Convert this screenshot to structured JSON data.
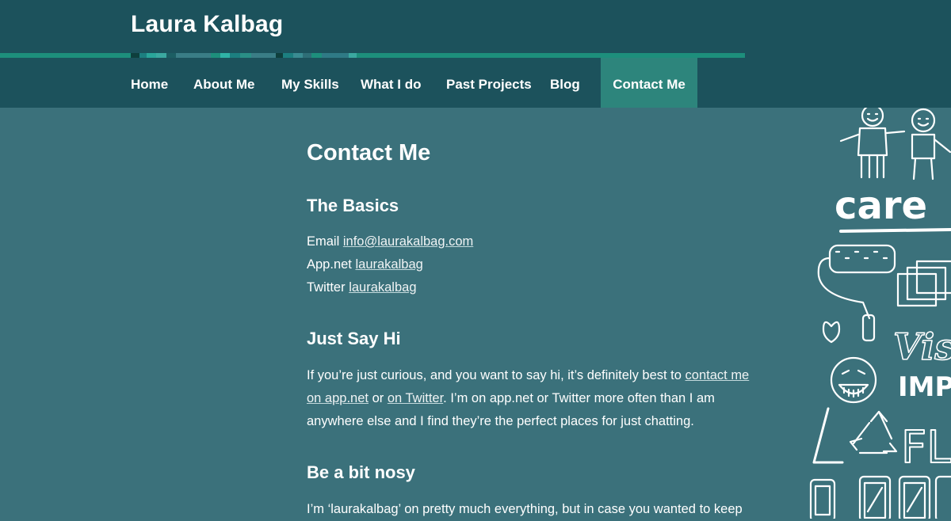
{
  "site": {
    "title": "Laura Kalbag"
  },
  "colors": {
    "header_bg": "#1c525c",
    "page_bg": "#3b717b",
    "accent": "#1d8f7c",
    "active_nav_bg": "#2d857c"
  },
  "nav": {
    "items": [
      {
        "label": "Home"
      },
      {
        "label": "About Me"
      },
      {
        "label": "My Skills"
      },
      {
        "label": "What I do"
      },
      {
        "label": "Past Projects"
      },
      {
        "label": "Blog"
      },
      {
        "label": "Contact Me"
      }
    ],
    "active": "Contact Me"
  },
  "main": {
    "title": "Contact Me",
    "basics": {
      "heading": "The Basics",
      "email_label": "Email",
      "email_link": "info@laurakalbag.com",
      "appnet_label": "App.net",
      "appnet_link": "laurakalbag",
      "twitter_label": "Twitter",
      "twitter_link": "laurakalbag"
    },
    "say_hi": {
      "heading": "Just Say Hi",
      "text_1": "If you’re just curious, and you want to say hi, it’s definitely best to ",
      "link_1": "contact me on app.net",
      "text_2": " or ",
      "link_2": "on Twitter",
      "text_3": ". I’m on app.net or Twitter more often than I am anywhere else and I find they’re the perfect places for just chatting."
    },
    "nosy": {
      "heading": "Be a bit nosy",
      "text": "I’m ‘laurakalbag’ on pretty much everything, but in case you wanted to keep"
    }
  },
  "illustration": {
    "words": [
      "care",
      "Vis",
      "IMP",
      "FL"
    ]
  }
}
